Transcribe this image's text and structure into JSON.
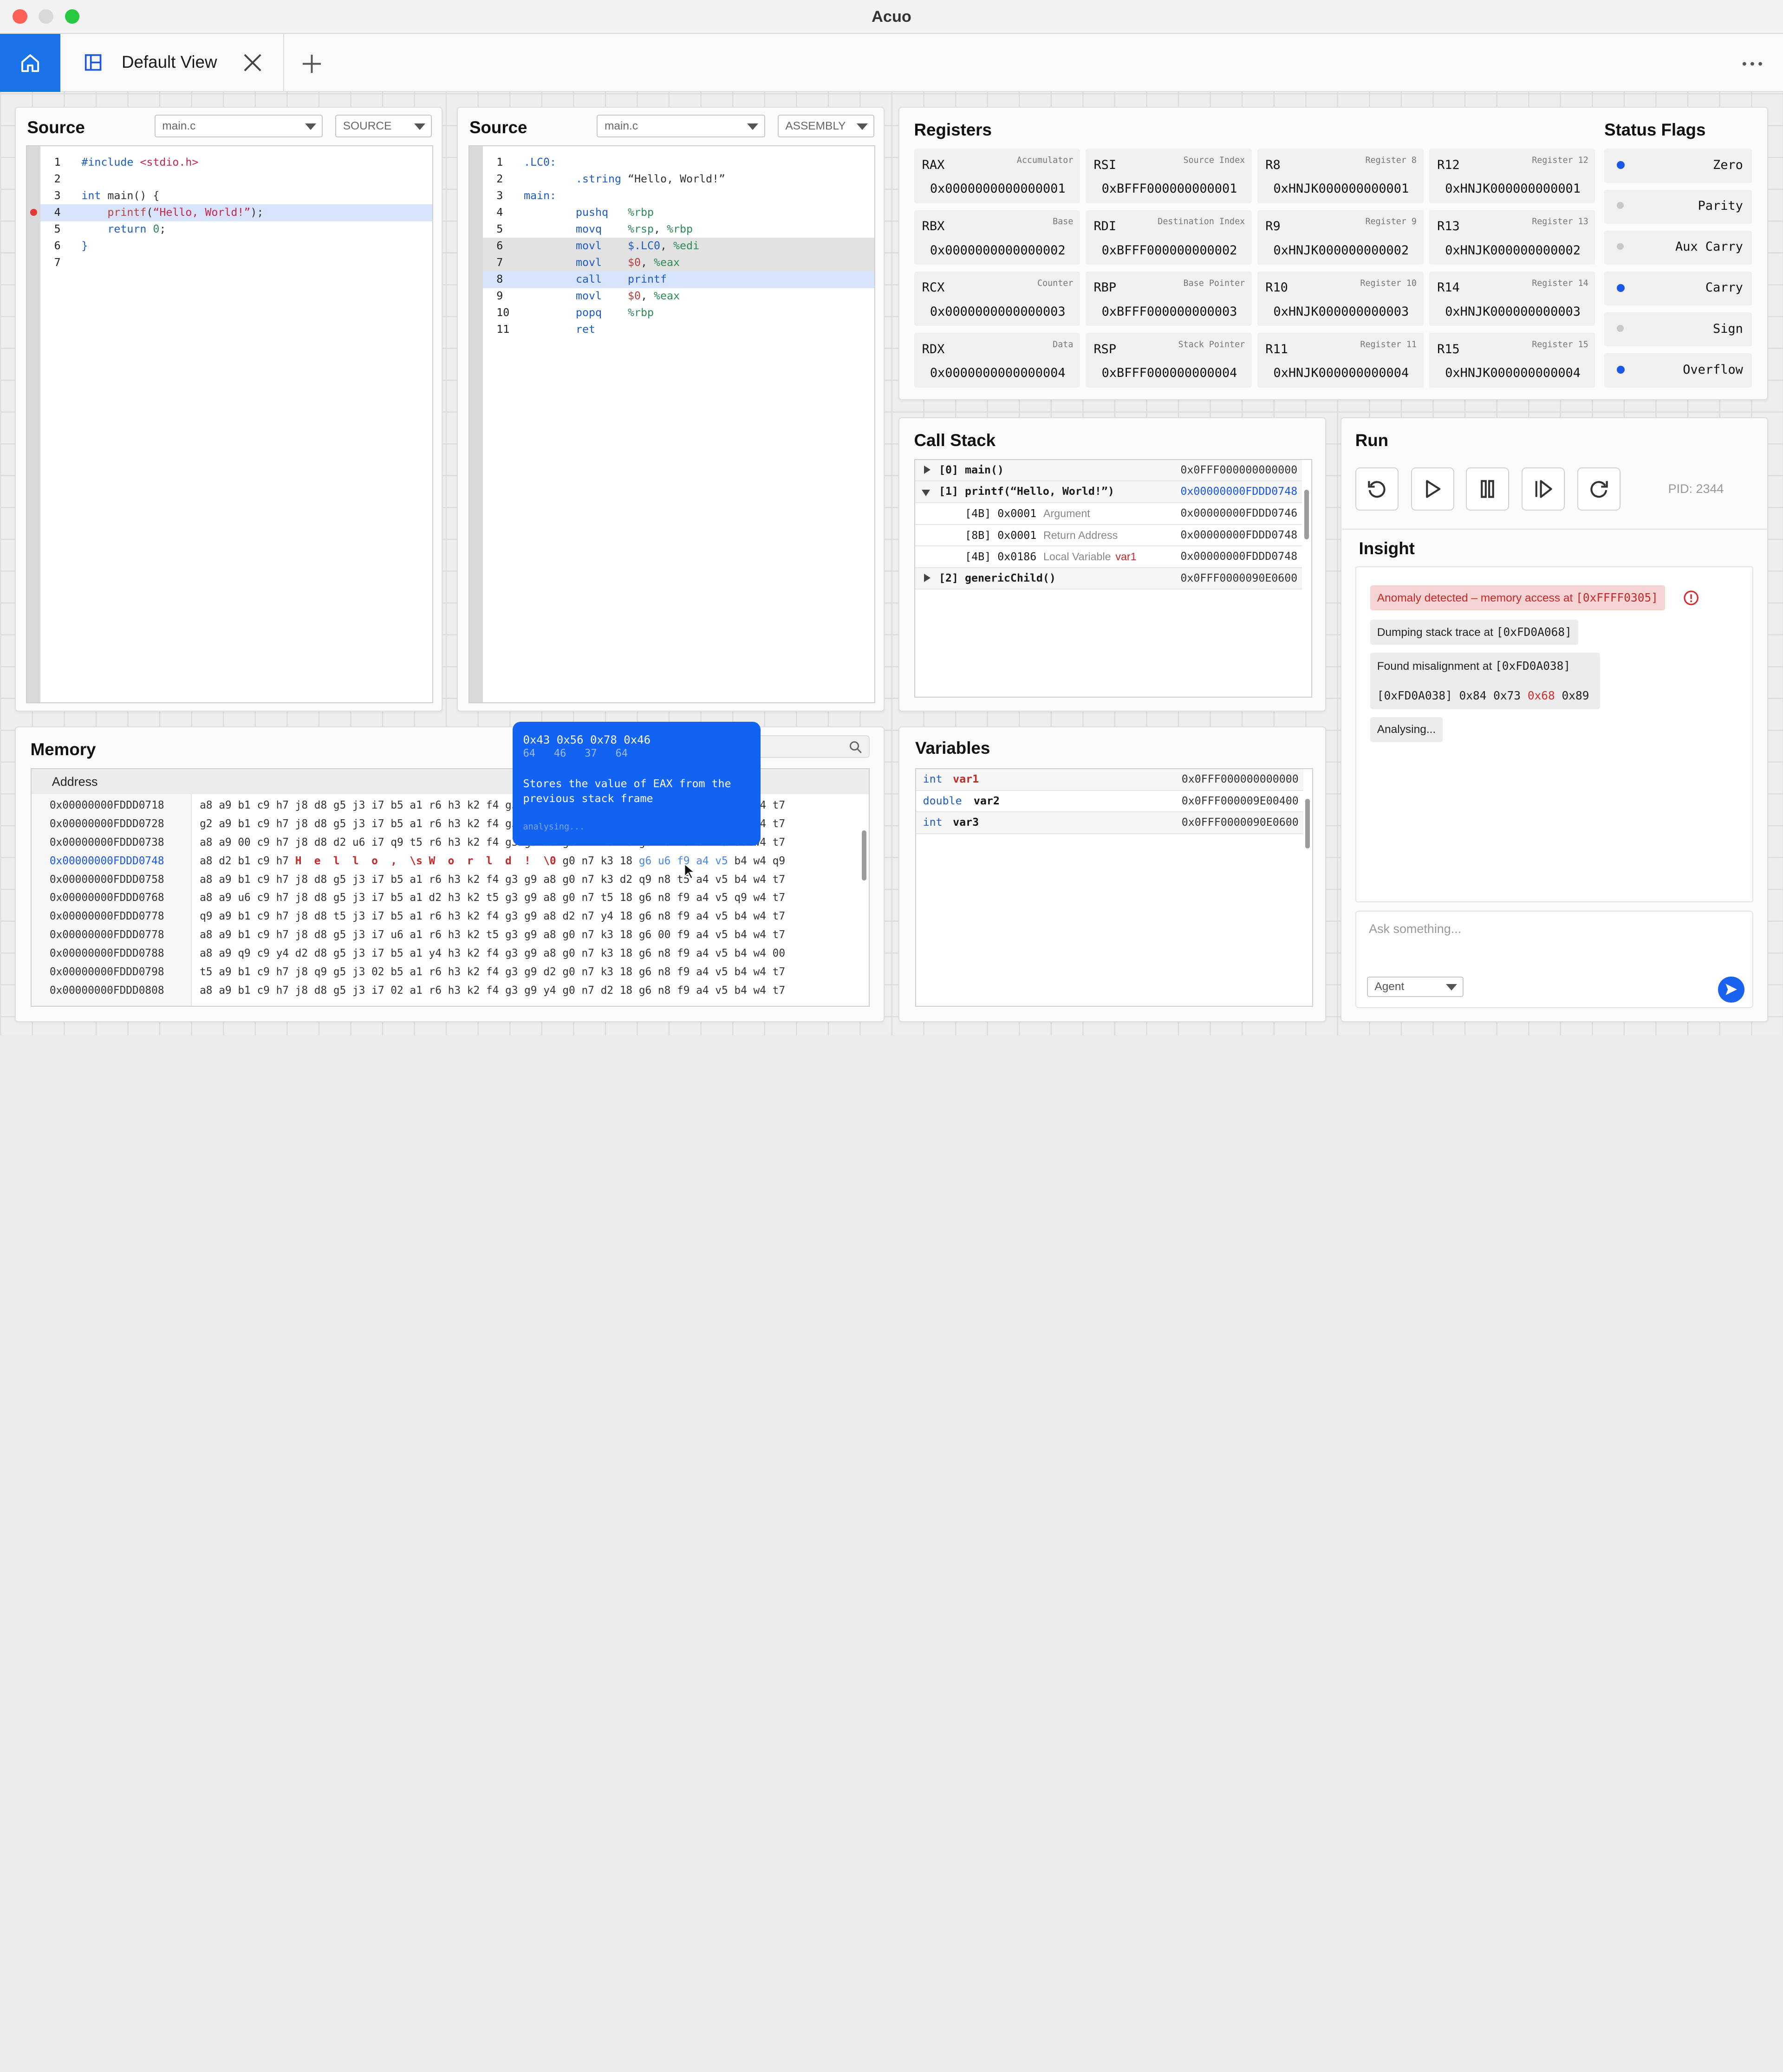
{
  "app": {
    "title": "Acuo"
  },
  "tabs": {
    "active_label": "Default View"
  },
  "source_c": {
    "title": "Source",
    "file": "main.c",
    "mode": "SOURCE",
    "lines": [
      {
        "n": "1",
        "parts": [
          [
            "kw",
            "#include "
          ],
          [
            "str",
            "<stdio.h>"
          ]
        ]
      },
      {
        "n": "2",
        "parts": []
      },
      {
        "n": "3",
        "parts": [
          [
            "kw",
            "int "
          ],
          [
            "pl",
            "main() {"
          ]
        ]
      },
      {
        "n": "4",
        "parts": [
          [
            "fn",
            "    printf"
          ],
          [
            "pl",
            "("
          ],
          [
            "str",
            "“Hello, World!”"
          ],
          [
            "pl",
            ");"
          ]
        ]
      },
      {
        "n": "5",
        "parts": [
          [
            "kw",
            "    return "
          ],
          [
            "num",
            "0"
          ],
          [
            "pl",
            ";"
          ]
        ]
      },
      {
        "n": "6",
        "parts": [
          [
            "kw",
            "}"
          ]
        ]
      },
      {
        "n": "7",
        "parts": []
      }
    ]
  },
  "source_asm": {
    "title": "Source",
    "file": "main.c",
    "mode": "ASSEMBLY",
    "lines": [
      {
        "n": "1",
        "parts": [
          [
            "dir",
            ".LC0:"
          ]
        ]
      },
      {
        "n": "2",
        "parts": [
          [
            "dir",
            "        .string "
          ],
          [
            "pl",
            "“Hello, World!”"
          ]
        ]
      },
      {
        "n": "3",
        "parts": [
          [
            "dir",
            "main:"
          ]
        ]
      },
      {
        "n": "4",
        "parts": [
          [
            "mn",
            "        pushq   "
          ],
          [
            "reg",
            "%rbp"
          ]
        ]
      },
      {
        "n": "5",
        "parts": [
          [
            "mn",
            "        movq    "
          ],
          [
            "reg",
            "%rsp"
          ],
          [
            "pl",
            ", "
          ],
          [
            "reg",
            "%rbp"
          ]
        ]
      },
      {
        "n": "6",
        "parts": [
          [
            "mn",
            "        movl    "
          ],
          [
            "dir",
            "$.LC0"
          ],
          [
            "pl",
            ", "
          ],
          [
            "reg",
            "%edi"
          ]
        ]
      },
      {
        "n": "7",
        "parts": [
          [
            "mn",
            "        movl    "
          ],
          [
            "fn",
            "$0"
          ],
          [
            "pl",
            ", "
          ],
          [
            "reg",
            "%eax"
          ]
        ]
      },
      {
        "n": "8",
        "parts": [
          [
            "mn",
            "        call    "
          ],
          [
            "dir",
            "printf"
          ]
        ]
      },
      {
        "n": "9",
        "parts": [
          [
            "mn",
            "        movl    "
          ],
          [
            "fn",
            "$0"
          ],
          [
            "pl",
            ", "
          ],
          [
            "reg",
            "%eax"
          ]
        ]
      },
      {
        "n": "10",
        "parts": [
          [
            "mn",
            "        popq    "
          ],
          [
            "reg",
            "%rbp"
          ]
        ]
      },
      {
        "n": "11",
        "parts": [
          [
            "mn",
            "        ret"
          ]
        ]
      }
    ]
  },
  "registers": {
    "title": "Registers",
    "items": [
      {
        "name": "RAX",
        "desc": "Accumulator",
        "value": "0x0000000000000001"
      },
      {
        "name": "RSI",
        "desc": "Source Index",
        "value": "0xBFFF000000000001"
      },
      {
        "name": "R8",
        "desc": "Register 8",
        "value": "0xHNJK000000000001"
      },
      {
        "name": "R12",
        "desc": "Register 12",
        "value": "0xHNJK000000000001"
      },
      {
        "name": "RBX",
        "desc": "Base",
        "value": "0x0000000000000002"
      },
      {
        "name": "RDI",
        "desc": "Destination Index",
        "value": "0xBFFF000000000002"
      },
      {
        "name": "R9",
        "desc": "Register 9",
        "value": "0xHNJK000000000002"
      },
      {
        "name": "R13",
        "desc": "Register 13",
        "value": "0xHNJK000000000002"
      },
      {
        "name": "RCX",
        "desc": "Counter",
        "value": "0x0000000000000003"
      },
      {
        "name": "RBP",
        "desc": "Base Pointer",
        "value": "0xBFFF000000000003"
      },
      {
        "name": "R10",
        "desc": "Register 10",
        "value": "0xHNJK000000000003"
      },
      {
        "name": "R14",
        "desc": "Register 14",
        "value": "0xHNJK000000000003"
      },
      {
        "name": "RDX",
        "desc": "Data",
        "value": "0x0000000000000004"
      },
      {
        "name": "RSP",
        "desc": "Stack Pointer",
        "value": "0xBFFF000000000004"
      },
      {
        "name": "R11",
        "desc": "Register 11",
        "value": "0xHNJK000000000004"
      },
      {
        "name": "R15",
        "desc": "Register 15",
        "value": "0xHNJK000000000004"
      }
    ]
  },
  "flags": {
    "title": "Status Flags",
    "items": [
      {
        "label": "Zero",
        "on": true
      },
      {
        "label": "Parity",
        "on": false
      },
      {
        "label": "Aux Carry",
        "on": false
      },
      {
        "label": "Carry",
        "on": true
      },
      {
        "label": "Sign",
        "on": false
      },
      {
        "label": "Overflow",
        "on": true
      }
    ],
    "on_color": "#1a56e8",
    "off_color": "#c8c8c8"
  },
  "callstack": {
    "title": "Call Stack",
    "rows": [
      {
        "label": "[0] main()",
        "addr": "0x0FFF000000000000",
        "kind": "frame",
        "open": false
      },
      {
        "label": "[1] printf(“Hello, World!”)",
        "addr": "0x00000000FDDD0748",
        "kind": "frame",
        "open": true,
        "addr_blue": true
      },
      {
        "label": "[4B] 0x0001",
        "sub": "Argument",
        "addr": "0x00000000FDDD0746",
        "kind": "child"
      },
      {
        "label": "[8B] 0x0001",
        "sub": "Return Address",
        "addr": "0x00000000FDDD0748",
        "kind": "child"
      },
      {
        "label": "[4B] 0x0186",
        "sub": "Local Variable",
        "subvar": "var1",
        "addr": "0x00000000FDDD0748",
        "kind": "child"
      },
      {
        "label": "[2] genericChild()",
        "addr": "0x0FFF0000090E0600",
        "kind": "frame",
        "open": false
      }
    ]
  },
  "run": {
    "title": "Run",
    "pid": "PID: 2344"
  },
  "insight": {
    "title": "Insight",
    "anomaly_text": "Anomaly detected – memory access at ",
    "anomaly_addr": "[0xFFFF0305]",
    "dump_text": "Dumping stack trace at ",
    "dump_addr": "[0xFD0A068]",
    "mis_text": "Found misalignment at ",
    "mis_addr": "[0xFD0A038]",
    "bytes_a": "[0xFD0A038] 0x84 0x73 ",
    "bytes_b": "0x68",
    "bytes_c": " 0x89",
    "analysing": "Analysing...",
    "ask_placeholder": "Ask something...",
    "agent": "Agent"
  },
  "variables": {
    "title": "Variables",
    "rows": [
      {
        "type": "int",
        "name": "var1",
        "addr": "0x0FFF000000000000",
        "red": true
      },
      {
        "type": "double",
        "name": "var2",
        "addr": "0x0FFF000009E00400",
        "red": false
      },
      {
        "type": "int",
        "name": "var3",
        "addr": "0x0FFF0000090E0600",
        "red": false
      }
    ]
  },
  "memory": {
    "title": "Memory",
    "header": "Address",
    "rows": [
      {
        "addr": "0x00000000FDDD0718",
        "bytes": "a8 a9 b1 c9 h7 j8 d8 g5 j3 i7 b5 a1 r6 h3 k2 f4 g3 g9 a8 g0 n7 k3 18 g6 n8 f9 a4 v5 b4 w4 t7"
      },
      {
        "addr": "0x00000000FDDD0728",
        "bytes": "g2 a9 b1 c9 h7 j8 d8 g5 j3 i7 b5 a1 r6 h3 k2 f4 g3 g9 a8 g0 n7 k3 18 g6 n8 f9 a4 v5 b4 w4 t7"
      },
      {
        "addr": "0x00000000FDDD0738",
        "bytes": "a8 a9 00 c9 h7 j8 d8 d2 u6 i7 q9 t5 r6 h3 k2 f4 g3 g9 a8 g0 n7 k3 18 g6 n8 f9 a4 v5 u6 w4 t7"
      },
      {
        "addr": "0x00000000FDDD0748",
        "hl": true,
        "pre": "a8 d2 b1 c9 h7 ",
        "str": "H  e  l  l  o  ,  \\s W  o  r  l  d  !  \\0",
        "post": " g0 n7 k3 18 ",
        "blu": "g6 u6 f9 a4 v5",
        "end": " b4 w4 q9"
      },
      {
        "addr": "0x00000000FDDD0758",
        "bytes": "a8 a9 b1 c9 h7 j8 d8 g5 j3 i7 b5 a1 r6 h3 k2 f4 g3 g9 a8 g0 n7 k3 d2 q9 n8 t5 a4 v5 b4 w4 t7"
      },
      {
        "addr": "0x00000000FDDD0768",
        "bytes": "a8 a9 u6 c9 h7 j8 d8 g5 j3 i7 b5 a1 d2 h3 k2 t5 g3 g9 a8 g0 n7 t5 18 g6 n8 f9 a4 v5 q9 w4 t7"
      },
      {
        "addr": "0x00000000FDDD0778",
        "bytes": "q9 a9 b1 c9 h7 j8 d8 t5 j3 i7 b5 a1 r6 h3 k2 f4 g3 g9 a8 d2 n7 y4 18 g6 n8 f9 a4 v5 b4 w4 t7"
      },
      {
        "addr": "0x00000000FDDD0778",
        "bytes": "a8 a9 b1 c9 h7 j8 d8 g5 j3 i7 u6 a1 r6 h3 k2 t5 g3 g9 a8 g0 n7 k3 18 g6 00 f9 a4 v5 b4 w4 t7"
      },
      {
        "addr": "0x00000000FDDD0788",
        "bytes": "a8 a9 q9 c9 y4 d2 d8 g5 j3 i7 b5 a1 y4 h3 k2 f4 g3 g9 a8 g0 n7 k3 18 g6 n8 f9 a4 v5 b4 w4 00"
      },
      {
        "addr": "0x00000000FDDD0798",
        "bytes": "t5 a9 b1 c9 h7 j8 q9 g5 j3 02 b5 a1 r6 h3 k2 f4 g3 g9 d2 g0 n7 k3 18 g6 n8 f9 a4 v5 b4 w4 t7"
      },
      {
        "addr": "0x00000000FDDD0808",
        "bytes": "a8 a9 b1 c9 h7 j8 d8 g5 j3 i7 02 a1 r6 h3 k2 f4 g3 g9 y4 g0 n7 d2 18 g6 n8 f9 a4 v5 b4 w4 t7"
      }
    ]
  },
  "tooltip": {
    "hex": "0x43 0x56 0x78 0x46",
    "dec": "64   46   37   64",
    "desc1": "Stores the value of EAX from the",
    "desc2": "previous stack frame",
    "status": "analysing..."
  }
}
